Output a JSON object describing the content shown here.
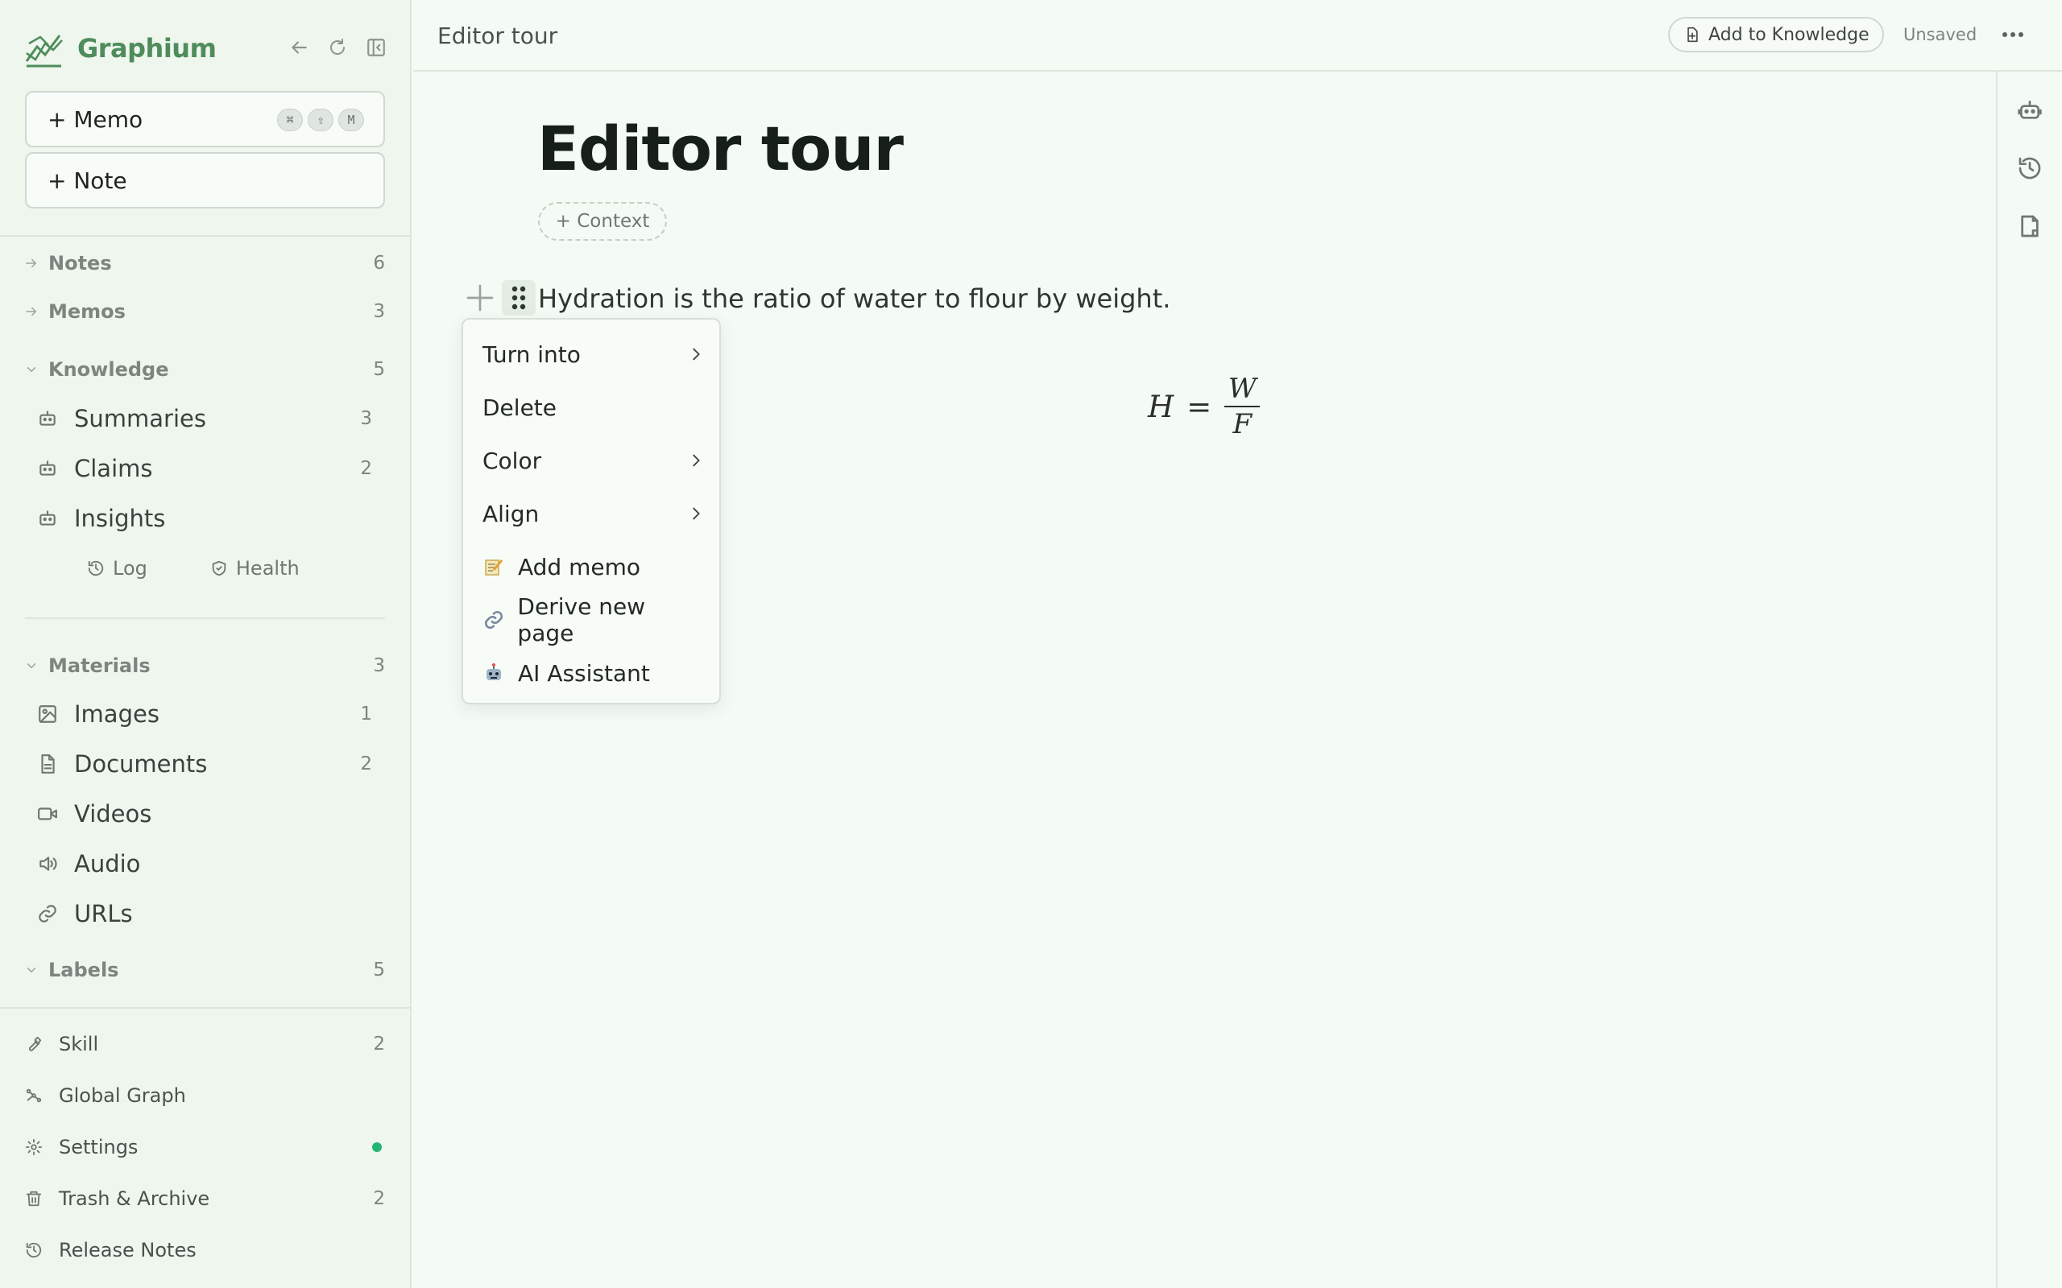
{
  "app": {
    "name": "Graphium"
  },
  "sidebar": {
    "new_memo": "+ Memo",
    "shortcut_keys": [
      "⌘",
      "⇧",
      "M"
    ],
    "new_note": "+ Note",
    "sections": {
      "notes": {
        "label": "Notes",
        "count": "6"
      },
      "memos": {
        "label": "Memos",
        "count": "3"
      },
      "knowledge": {
        "label": "Knowledge",
        "count": "5"
      },
      "materials": {
        "label": "Materials",
        "count": "3"
      },
      "labels": {
        "label": "Labels",
        "count": "5"
      }
    },
    "knowledge_items": [
      {
        "label": "Summaries",
        "count": "3"
      },
      {
        "label": "Claims",
        "count": "2"
      },
      {
        "label": "Insights",
        "count": ""
      }
    ],
    "knowledge_sub": {
      "log": "Log",
      "health": "Health"
    },
    "material_items": [
      {
        "label": "Images",
        "count": "1"
      },
      {
        "label": "Documents",
        "count": "2"
      },
      {
        "label": "Videos",
        "count": ""
      },
      {
        "label": "Audio",
        "count": ""
      },
      {
        "label": "URLs",
        "count": ""
      }
    ],
    "bottom_items": [
      {
        "label": "Skill",
        "count": "2"
      },
      {
        "label": "Global Graph",
        "count": ""
      },
      {
        "label": "Settings",
        "count": ""
      },
      {
        "label": "Trash & Archive",
        "count": "2"
      },
      {
        "label": "Release Notes",
        "count": ""
      }
    ],
    "settings_status_color": "#22b573"
  },
  "header": {
    "breadcrumb": "Editor tour",
    "add_to_knowledge": "Add to Knowledge",
    "save_status": "Unsaved"
  },
  "editor": {
    "title": "Editor tour",
    "context_button": "+ Context",
    "paragraph": "Hydration is the ratio of water to flour by weight.",
    "math": {
      "lhs": "H",
      "eq": "=",
      "numerator": "W",
      "denominator": "F"
    }
  },
  "context_menu": {
    "items": [
      {
        "label": "Turn into",
        "submenu": true
      },
      {
        "label": "Delete",
        "submenu": false
      },
      {
        "label": "Color",
        "submenu": true
      },
      {
        "label": "Align",
        "submenu": true
      },
      {
        "label": "Add memo",
        "icon": "memo-emoji-icon"
      },
      {
        "label": "Derive new page",
        "icon": "link-emoji-icon"
      },
      {
        "label": "AI Assistant",
        "icon": "robot-emoji-icon"
      }
    ]
  },
  "colors": {
    "brand": "#4f8c5b",
    "background": "#f4faf4",
    "sidebar": "#eef6ee"
  }
}
